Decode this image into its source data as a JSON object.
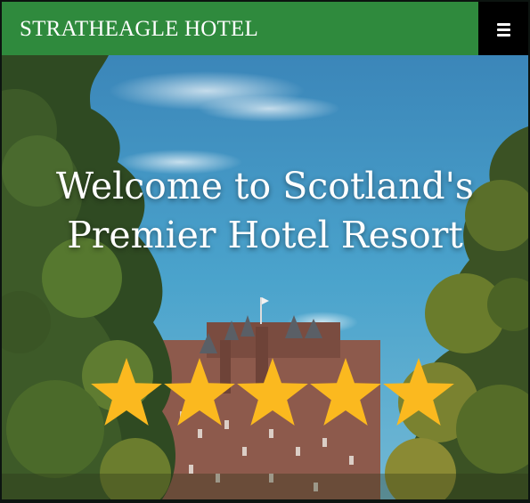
{
  "header": {
    "brand": "STRATHEAGLE HOTEL",
    "menu_icon": "hamburger-menu-icon"
  },
  "hero": {
    "headline_line1": "Welcome to Scotland's",
    "headline_line2": "Premier Hotel Resort",
    "rating": {
      "stars": 5,
      "max": 5,
      "icon": "star-icon",
      "color": "#fbb91f"
    }
  },
  "colors": {
    "header_bg": "#2f8a3d",
    "menu_bg": "#000000",
    "sky": "#3f97c6"
  }
}
